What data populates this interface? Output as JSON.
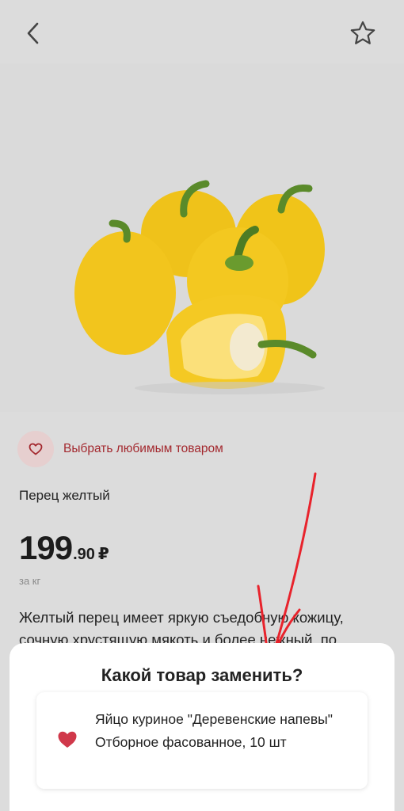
{
  "header": {
    "back_icon": "chevron-left-icon",
    "favorite_icon": "star-outline-icon"
  },
  "product": {
    "image_alt_icon": "yellow-bell-peppers-image",
    "favorite_label": "Выбрать любимым товаром",
    "title": "Перец желтый",
    "price_main": "199",
    "price_cents": ".90",
    "currency": "₽",
    "unit": "за кг",
    "description_line1": "Желтый перец имеет яркую съедобную кожицу,",
    "description_line2": "сочную хрустящую мякоть и более нежный, по"
  },
  "sheet": {
    "title": "Какой товар заменить?",
    "option_text": "Яйцо куриное \"Деревенские напевы\" Отборное фасованное, 10 шт"
  },
  "colors": {
    "accent_red": "#a3282e",
    "heart_red": "#d0384a",
    "annotation_arrow": "#e8232c"
  }
}
